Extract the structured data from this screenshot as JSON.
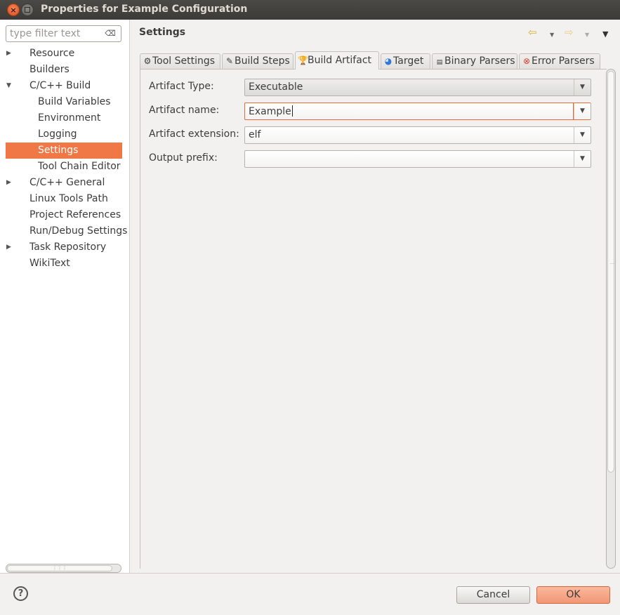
{
  "window": {
    "title": "Properties for Example Configuration"
  },
  "filter": {
    "placeholder": "type filter text"
  },
  "tree": [
    {
      "label": "Resource",
      "level": 0,
      "twisty": "collapsed"
    },
    {
      "label": "Builders",
      "level": 0,
      "twisty": "none"
    },
    {
      "label": "C/C++ Build",
      "level": 0,
      "twisty": "expanded"
    },
    {
      "label": "Build Variables",
      "level": 1,
      "twisty": "none"
    },
    {
      "label": "Environment",
      "level": 1,
      "twisty": "none"
    },
    {
      "label": "Logging",
      "level": 1,
      "twisty": "none"
    },
    {
      "label": "Settings",
      "level": 1,
      "twisty": "none",
      "selected": true
    },
    {
      "label": "Tool Chain Editor",
      "level": 1,
      "twisty": "none"
    },
    {
      "label": "C/C++ General",
      "level": 0,
      "twisty": "collapsed"
    },
    {
      "label": "Linux Tools Path",
      "level": 0,
      "twisty": "none"
    },
    {
      "label": "Project References",
      "level": 0,
      "twisty": "none"
    },
    {
      "label": "Run/Debug Settings",
      "level": 0,
      "twisty": "none"
    },
    {
      "label": "Task Repository",
      "level": 0,
      "twisty": "collapsed"
    },
    {
      "label": "WikiText",
      "level": 0,
      "twisty": "none"
    }
  ],
  "page": {
    "title": "Settings"
  },
  "tabs": [
    {
      "label": "Tool Settings",
      "icon": "tool-settings-icon",
      "active": false
    },
    {
      "label": "Build Steps",
      "icon": "build-steps-icon",
      "active": false
    },
    {
      "label": "Build Artifact",
      "icon": "trophy-icon",
      "active": true
    },
    {
      "label": "Target",
      "icon": "target-icon",
      "active": false
    },
    {
      "label": "Binary Parsers",
      "icon": "binary-icon",
      "active": false
    },
    {
      "label": "Error Parsers",
      "icon": "error-icon",
      "active": false
    }
  ],
  "form": {
    "artifact_type_label": "Artifact Type:",
    "artifact_type_value": "Executable",
    "artifact_name_label": "Artifact name:",
    "artifact_name_value": "Example",
    "artifact_extension_label": "Artifact extension:",
    "artifact_extension_value": "elf",
    "output_prefix_label": "Output prefix:",
    "output_prefix_value": ""
  },
  "buttons": {
    "cancel": "Cancel",
    "ok": "OK"
  },
  "colors": {
    "accent": "#f07746",
    "ok_button": "#f19776",
    "titlebar": "#3c3b37"
  }
}
